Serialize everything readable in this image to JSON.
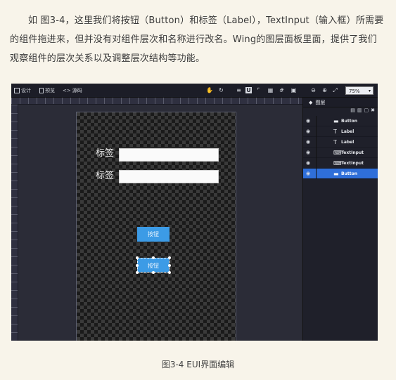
{
  "paragraph": "如 图3-4，这里我们将按钮（Button）和标签（Label），TextInput（输入框）所需要的组件拖进来，但并没有对组件层次和名称进行改名。Wing的图层面板里面，提供了我们观察组件的层次关系以及调整层次结构等功能。",
  "toolbar": {
    "design_label": "设计",
    "preview_label": "预览",
    "source_label": "源码",
    "zoom_value": "75%"
  },
  "artboard": {
    "labels": [
      "标签",
      "标签"
    ],
    "buttons": [
      "按钮",
      "按钮"
    ]
  },
  "layers_panel": {
    "title": "图层",
    "items": [
      {
        "name": "Button",
        "icon": "button-icon"
      },
      {
        "name": "Label",
        "icon": "label-icon"
      },
      {
        "name": "Label",
        "icon": "label-icon"
      },
      {
        "name": "TextInput",
        "icon": "textinput-icon"
      },
      {
        "name": "TextInput",
        "icon": "textinput-icon"
      },
      {
        "name": "Button",
        "icon": "button-icon",
        "selected": true
      }
    ]
  },
  "caption": "图3-4 EUI界面编辑"
}
